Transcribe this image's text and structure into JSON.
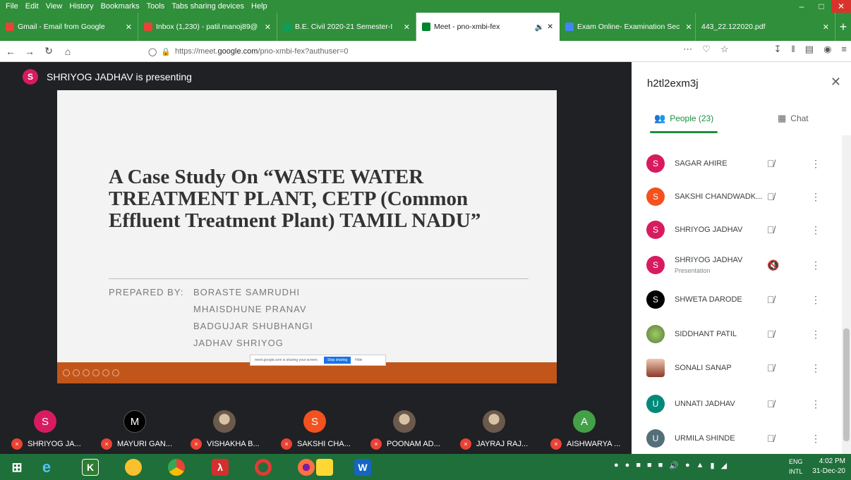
{
  "menubar": [
    "File",
    "Edit",
    "View",
    "History",
    "Bookmarks",
    "Tools",
    "Tabs sharing devices",
    "Help"
  ],
  "tabs": [
    {
      "label": "Gmail - Email from Google",
      "icon_color": "#ea4335"
    },
    {
      "label": "Inbox (1,230) - patil.manoj89@",
      "icon_color": "#ea4335"
    },
    {
      "label": "B.E. Civil 2020-21 Semester-I",
      "icon_color": "#0f9d58"
    },
    {
      "label": "Meet - pno-xmbi-fex",
      "icon_color": "#00832d",
      "active": true
    },
    {
      "label": "Exam Online- Examination Sec",
      "icon_color": "#4285f4"
    },
    {
      "label": "443_22.122020.pdf",
      "icon_color": "#2f8f3a"
    }
  ],
  "address": {
    "prefix": "https://meet.",
    "host": "google.com",
    "path": "/pno-xmbi-fex?authuser=0"
  },
  "meeting": {
    "presenter_initial": "S",
    "presenting_label": "SHRIYOG JADHAV is presenting",
    "share_notice": "meet.google.com is sharing your screen.",
    "stop_sharing": "Stop sharing",
    "hide": "Hide"
  },
  "slide": {
    "title": "A Case Study On “WASTE WATER TREATMENT PLANT, CETP (Common Effluent Treatment Plant) TAMIL NADU”",
    "prepared_by": "PREPARED BY:",
    "authors": [
      "BORASTE SAMRUDHI",
      "MHAISDHUNE PRANAV",
      "BADGUJAR SHUBHANGI",
      "JADHAV SHRIYOG"
    ],
    "footer_color": "#c2561a"
  },
  "tiles": [
    {
      "initial": "S",
      "color": "#d81b60",
      "name": "SHRIYOG JA..."
    },
    {
      "initial": "M",
      "color": "#000000",
      "name": "MAYURI GAN..."
    },
    {
      "initial": "",
      "color": "photo",
      "name": "VISHAKHA B..."
    },
    {
      "initial": "S",
      "color": "#f4511e",
      "name": "SAKSHI CHA..."
    },
    {
      "initial": "",
      "color": "photo",
      "name": "POONAM AD..."
    },
    {
      "initial": "",
      "color": "photo",
      "name": "JAYRAJ RAJ..."
    },
    {
      "initial": "A",
      "color": "#43a047",
      "name": "AISHWARYA ..."
    }
  ],
  "panel": {
    "meeting_code": "h2tl2exm3j",
    "people_tab": "People (23)",
    "chat_tab": "Chat",
    "people": [
      {
        "initial": "S",
        "color": "#d81b60",
        "name": "SAGAR AHIRE",
        "sub": ""
      },
      {
        "initial": "S",
        "color": "#f4511e",
        "name": "SAKSHI CHANDWADK...",
        "sub": ""
      },
      {
        "initial": "S",
        "color": "#d81b60",
        "name": "SHRIYOG JADHAV",
        "sub": ""
      },
      {
        "initial": "S",
        "color": "#d81b60",
        "name": "SHRIYOG JADHAV",
        "sub": "Presentation"
      },
      {
        "initial": "S",
        "color": "#000000",
        "name": "SHWETA DARODE",
        "sub": ""
      },
      {
        "initial": "",
        "color": "photo",
        "name": "SIDDHANT PATIL",
        "sub": ""
      },
      {
        "initial": "",
        "color": "photo",
        "name": "SONALI SANAP",
        "sub": ""
      },
      {
        "initial": "U",
        "color": "#00897b",
        "name": "UNNATI JADHAV",
        "sub": ""
      },
      {
        "initial": "U",
        "color": "#546e7a",
        "name": "URMILA SHINDE",
        "sub": ""
      }
    ]
  },
  "taskbar": {
    "lang_top": "ENG",
    "lang_bottom": "INTL",
    "time": "4:02 PM",
    "date": "31-Dec-20"
  }
}
